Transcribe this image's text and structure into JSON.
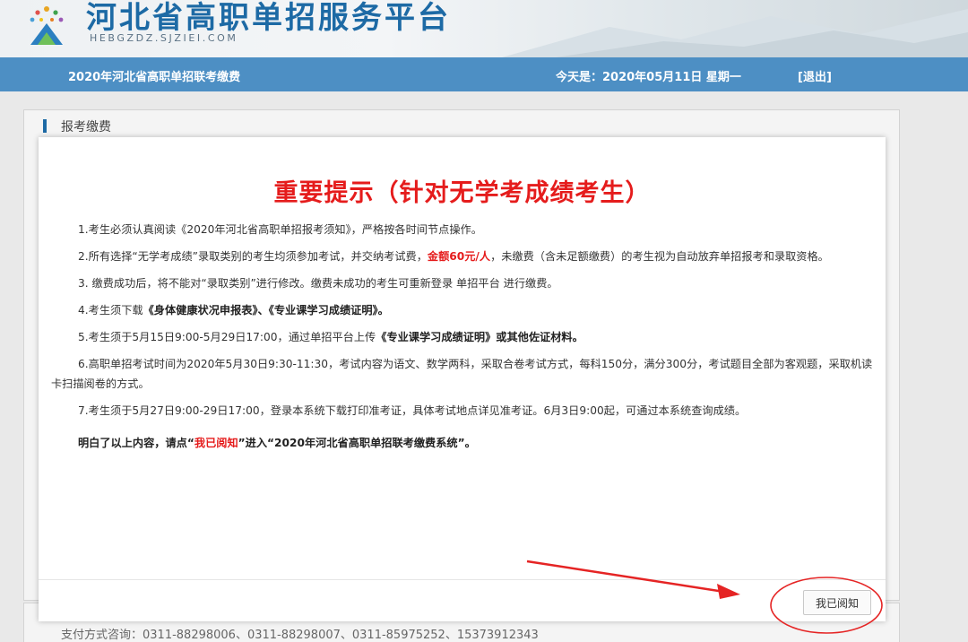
{
  "header": {
    "site_title": "河北省高职单招服务平台",
    "site_domain": "HEBGZDZ.SJZIEI.COM",
    "brand_color": "#1d6aa5"
  },
  "nav": {
    "system_name": "2020年河北省高职单招联考缴费",
    "date_text": "今天是：2020年05月11日 星期一",
    "logout": "[退出]",
    "bar_color": "#4d8fc4"
  },
  "panel": {
    "heading": "报考缴费",
    "pay_consult": "支付方式咨询：0311-88298006、0311-88298007、0311-85975252、15373912343"
  },
  "modal": {
    "title": "重要提示（针对无学考成绩考生）",
    "item1": "1.考生必须认真阅读《2020年河北省高职单招报考须知》，严格按各时间节点操作。",
    "item2_a": "2.所有选择“无学考成绩”录取类别的考生均须参加考试，并交纳考试费，",
    "item2_amount": "金额60元/人",
    "item2_b": "，未缴费（含未足额缴费）的考生视为自动放弃单招报考和录取资格。",
    "item3": "3. 缴费成功后，将不能对“录取类别”进行修改。缴费未成功的考生可重新登录 单招平台 进行缴费。",
    "item4_a": "4.考生须下载",
    "item4_b": "《身体健康状况申报表》、《专业课学习成绩证明》。",
    "item5_a": "5.考生须于5月15日9:00-5月29日17:00，通过单招平台上传",
    "item5_b": "《专业课学习成绩证明》或其他佐证材料。",
    "item6": "6.高职单招考试时间为2020年5月30日9:30-11:30，考试内容为语文、数学两科，采取合卷考试方式，每科150分，满分300分，考试题目全部为客观题，采取机读卡扫描阅卷的方式。",
    "item7": "7.考生须于5月27日9:00-29日17:00，登录本系统下载打印准考证，具体考试地点详见准考证。6月3日9:00起，可通过本系统查询成绩。",
    "final_a": "明白了以上内容，请点“",
    "final_highlight": "我已阅知",
    "final_b": "”进入“2020年河北省高职单招联考缴费系统”。",
    "ack_button": "我已阅知",
    "accent_color": "#e51c1c"
  }
}
